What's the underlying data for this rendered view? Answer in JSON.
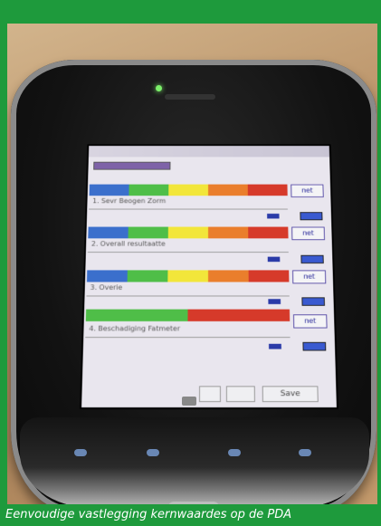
{
  "caption": "Eenvoudige vastlegging kernwaardes op de PDA",
  "screen": {
    "rows": [
      {
        "segments": [
          "",
          "",
          "",
          "",
          ""
        ],
        "label": "1. Sevr Beogen Zorm",
        "button": "net"
      },
      {
        "segments": [
          "",
          "",
          "",
          "",
          ""
        ],
        "label": "2. Overall resultaatte",
        "button": "net"
      },
      {
        "segments": [
          "",
          "",
          "",
          "",
          ""
        ],
        "label": "3. Overie",
        "button": "net"
      },
      {
        "segments": [
          "",
          ""
        ],
        "label": "4. Beschadiging Fatmeter",
        "button": "net"
      }
    ],
    "bottom_buttons": [
      "",
      "",
      "Save"
    ]
  },
  "colors": {
    "frame_green": "#1e9a3c",
    "blue": "#3b6fcc",
    "green": "#4fbe48",
    "yellow": "#f2e63a",
    "orange": "#ea7e2c",
    "red": "#d63a2a"
  }
}
